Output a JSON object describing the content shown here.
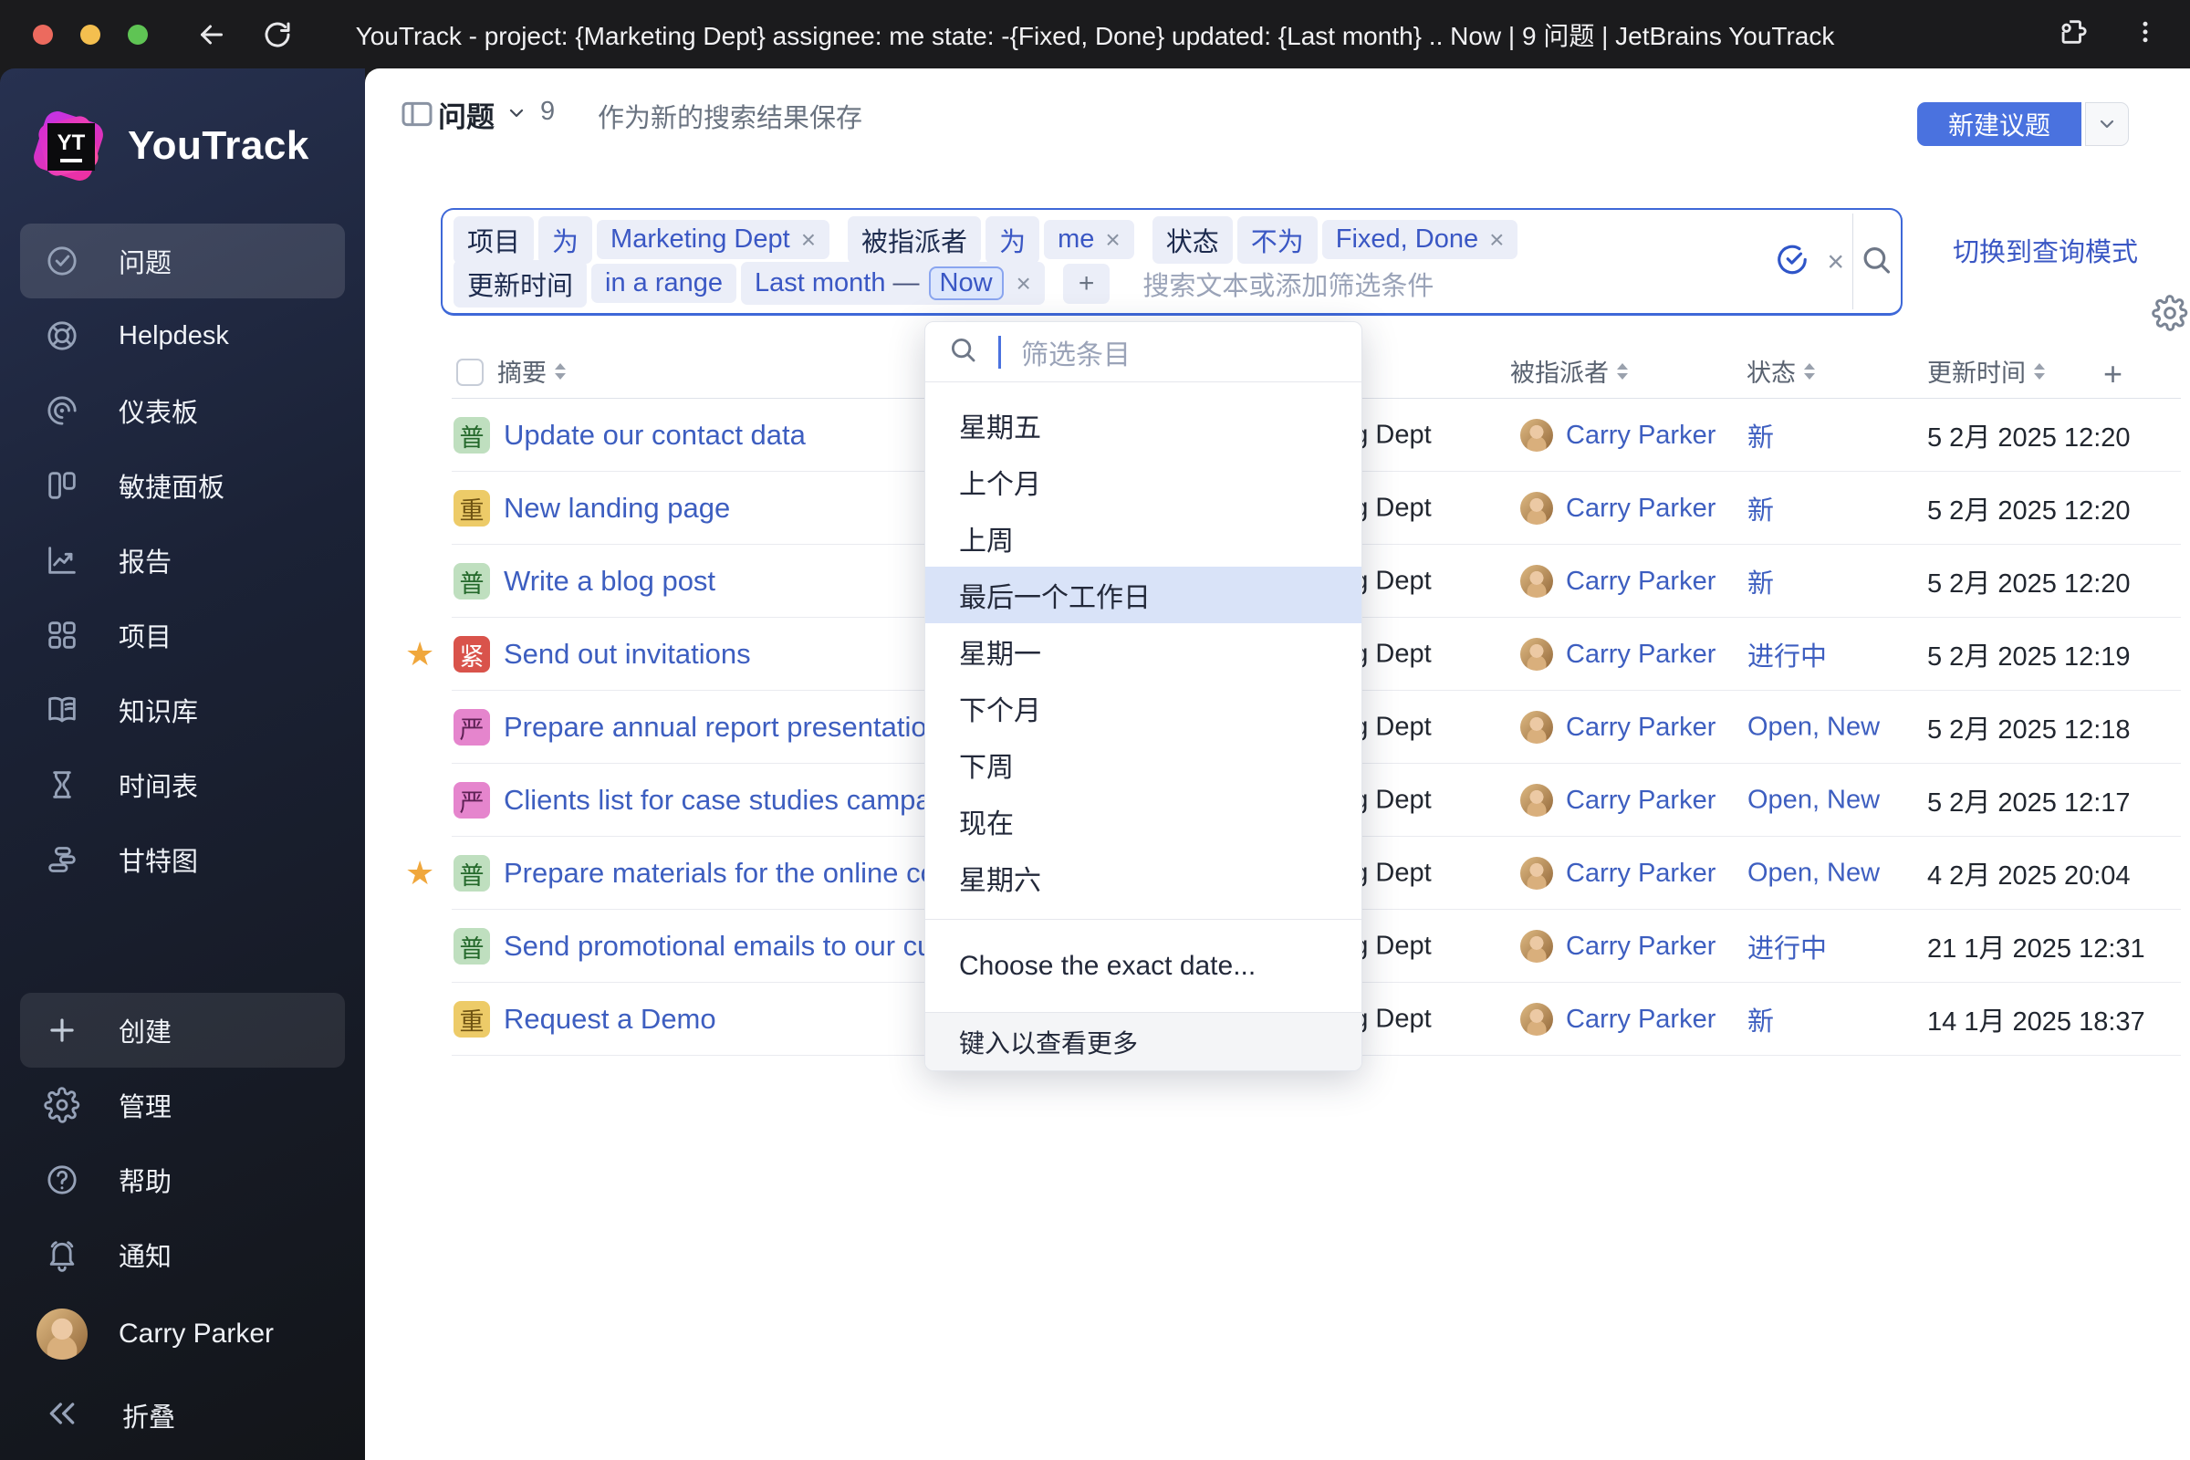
{
  "browser": {
    "title": "YouTrack - project: {Marketing Dept} assignee: me state: -{Fixed, Done} updated: {Last month} .. Now | 9 问题 | JetBrains YouTrack"
  },
  "icons": {
    "close": "×",
    "plus": "+",
    "star": "★",
    "dash": "—",
    "collapse": "«"
  },
  "sidebar": {
    "logo_badge": "YT",
    "logo_text": "YouTrack",
    "items": [
      {
        "label": "问题",
        "icon": "issues",
        "active": true
      },
      {
        "label": "Helpdesk",
        "icon": "helpdesk",
        "active": false
      },
      {
        "label": "仪表板",
        "icon": "dashboard",
        "active": false
      },
      {
        "label": "敏捷面板",
        "icon": "agile",
        "active": false
      },
      {
        "label": "报告",
        "icon": "report",
        "active": false
      },
      {
        "label": "项目",
        "icon": "projects",
        "active": false
      },
      {
        "label": "知识库",
        "icon": "knowledge",
        "active": false
      },
      {
        "label": "时间表",
        "icon": "timesheet",
        "active": false
      },
      {
        "label": "甘特图",
        "icon": "gantt",
        "active": false
      }
    ],
    "create_label": "创建",
    "bottom_items": [
      {
        "label": "管理",
        "icon": "gear"
      },
      {
        "label": "帮助",
        "icon": "help"
      },
      {
        "label": "通知",
        "icon": "bell"
      }
    ],
    "user_name": "Carry Parker",
    "collapse_label": "折叠"
  },
  "header": {
    "title": "问题",
    "count": "9",
    "save_search": "作为新的搜索结果保存",
    "new_issue": "新建议题"
  },
  "filter": {
    "groups": [
      {
        "field": "项目",
        "op": "为",
        "value": "Marketing Dept"
      },
      {
        "field": "被指派者",
        "op": "为",
        "value": "me"
      },
      {
        "field": "状态",
        "op": "不为",
        "value": "Fixed, Done"
      }
    ],
    "range": {
      "field": "更新时间",
      "op": "in a range",
      "start": "Last month",
      "dash": "—",
      "end": "Now"
    },
    "placeholder": "搜索文本或添加筛选条件",
    "switch_mode": "切换到查询模式"
  },
  "dropdown": {
    "search_placeholder": "筛选条目",
    "items": [
      "星期五",
      "上个月",
      "上周",
      "最后一个工作日",
      "星期一",
      "下个月",
      "下周",
      "现在",
      "星期六"
    ],
    "highlighted_index": 3,
    "exact_date": "Choose the exact date...",
    "footer": "键入以查看更多"
  },
  "table": {
    "headers": {
      "summary": "摘要",
      "assignee": "被指派者",
      "state": "状态",
      "updated": "更新时间"
    },
    "rows": [
      {
        "starred": false,
        "priority_glyph": "普",
        "priority": "normal",
        "title": "Update our contact data",
        "project": "Marketing Dept",
        "assignee": "Carry Parker",
        "state": "新",
        "updated": "5 2月 2025 12:20"
      },
      {
        "starred": false,
        "priority_glyph": "重",
        "priority": "major",
        "title": "New landing page",
        "project": "Marketing Dept",
        "assignee": "Carry Parker",
        "state": "新",
        "updated": "5 2月 2025 12:20"
      },
      {
        "starred": false,
        "priority_glyph": "普",
        "priority": "normal",
        "title": "Write a blog post",
        "project": "Marketing Dept",
        "assignee": "Carry Parker",
        "state": "新",
        "updated": "5 2月 2025 12:20"
      },
      {
        "starred": true,
        "priority_glyph": "紧",
        "priority": "urgent",
        "title": "Send out invitations",
        "project": "Marketing Dept",
        "assignee": "Carry Parker",
        "state": "进行中",
        "updated": "5 2月 2025 12:19"
      },
      {
        "starred": false,
        "priority_glyph": "严",
        "priority": "severe",
        "title": "Prepare annual report presentation",
        "project": "Marketing Dept",
        "assignee": "Carry Parker",
        "state": "Open, New",
        "updated": "5 2月 2025 12:18"
      },
      {
        "starred": false,
        "priority_glyph": "严",
        "priority": "severe",
        "title": "Clients list for case studies campaign",
        "project": "Marketing Dept",
        "assignee": "Carry Parker",
        "state": "Open, New",
        "updated": "5 2月 2025 12:17"
      },
      {
        "starred": true,
        "priority_glyph": "普",
        "priority": "normal",
        "title": "Prepare materials for the online conference",
        "project": "Marketing Dept",
        "assignee": "Carry Parker",
        "state": "Open, New",
        "updated": "4 2月 2025 20:04"
      },
      {
        "starred": false,
        "priority_glyph": "普",
        "priority": "normal",
        "title": "Send promotional emails to our customers",
        "project": "Marketing Dept",
        "assignee": "Carry Parker",
        "state": "进行中",
        "updated": "21 1月 2025 12:31"
      },
      {
        "starred": false,
        "priority_glyph": "重",
        "priority": "major",
        "title": "Request a Demo",
        "project": "Marketing Dept",
        "assignee": "Carry Parker",
        "state": "新",
        "updated": "14 1月 2025 18:37"
      }
    ]
  }
}
